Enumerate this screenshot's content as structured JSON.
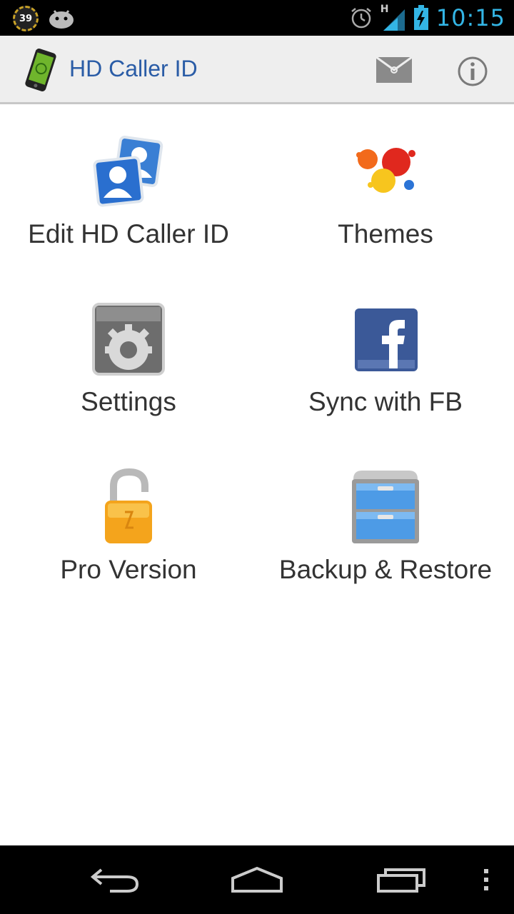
{
  "status_bar": {
    "notification_count": "39",
    "network_type": "H",
    "time": "10:15"
  },
  "action_bar": {
    "title": "HD Caller ID",
    "icons": {
      "app": "phone-app-icon",
      "mail": "mail-icon",
      "info": "info-icon"
    }
  },
  "menu": {
    "items": [
      {
        "label": "Edit HD Caller ID",
        "icon": "contacts-icon"
      },
      {
        "label": "Themes",
        "icon": "paint-splash-icon"
      },
      {
        "label": "Settings",
        "icon": "gear-icon"
      },
      {
        "label": "Sync with FB",
        "icon": "facebook-icon"
      },
      {
        "label": "Pro Version",
        "icon": "unlocked-padlock-icon"
      },
      {
        "label": "Backup & Restore",
        "icon": "filing-cabinet-icon"
      }
    ]
  },
  "colors": {
    "title_blue": "#2a5ca6",
    "clock_blue": "#33b5e5",
    "action_bar_bg": "#eeeeee"
  }
}
